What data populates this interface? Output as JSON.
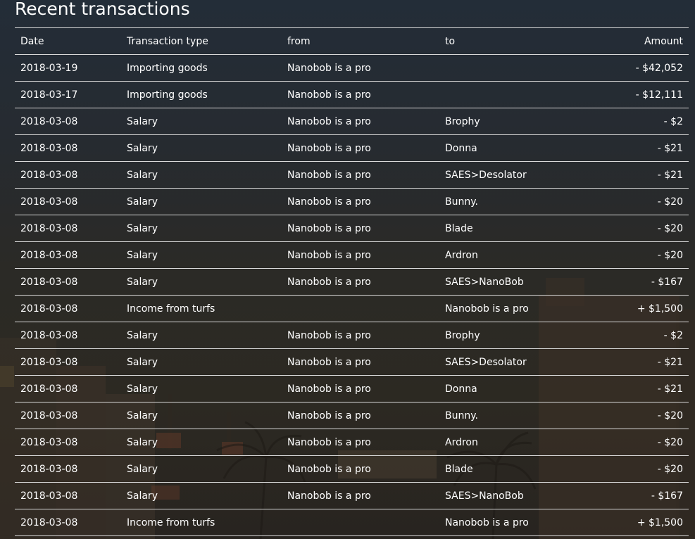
{
  "page": {
    "title": "Recent transactions"
  },
  "table": {
    "columns": {
      "date": "Date",
      "type": "Transaction type",
      "from": "from",
      "to": "to",
      "amount": "Amount"
    },
    "rows": [
      {
        "date": "2018-03-19",
        "type": "Importing goods",
        "from": "Nanobob is a pro",
        "to": "",
        "amount": "- $42,052"
      },
      {
        "date": "2018-03-17",
        "type": "Importing goods",
        "from": "Nanobob is a pro",
        "to": "",
        "amount": "- $12,111"
      },
      {
        "date": "2018-03-08",
        "type": "Salary",
        "from": "Nanobob is a pro",
        "to": "Brophy",
        "amount": "- $2"
      },
      {
        "date": "2018-03-08",
        "type": "Salary",
        "from": "Nanobob is a pro",
        "to": "Donna",
        "amount": "- $21"
      },
      {
        "date": "2018-03-08",
        "type": "Salary",
        "from": "Nanobob is a pro",
        "to": "SAES>Desolator",
        "amount": "- $21"
      },
      {
        "date": "2018-03-08",
        "type": "Salary",
        "from": "Nanobob is a pro",
        "to": "Bunny.",
        "amount": "- $20"
      },
      {
        "date": "2018-03-08",
        "type": "Salary",
        "from": "Nanobob is a pro",
        "to": "Blade",
        "amount": "- $20"
      },
      {
        "date": "2018-03-08",
        "type": "Salary",
        "from": "Nanobob is a pro",
        "to": "Ardron",
        "amount": "- $20"
      },
      {
        "date": "2018-03-08",
        "type": "Salary",
        "from": "Nanobob is a pro",
        "to": "SAES>NanoBob",
        "amount": "- $167"
      },
      {
        "date": "2018-03-08",
        "type": "Income from turfs",
        "from": "",
        "to": "Nanobob is a pro",
        "amount": "+ $1,500"
      },
      {
        "date": "2018-03-08",
        "type": "Salary",
        "from": "Nanobob is a pro",
        "to": "Brophy",
        "amount": "- $2"
      },
      {
        "date": "2018-03-08",
        "type": "Salary",
        "from": "Nanobob is a pro",
        "to": "SAES>Desolator",
        "amount": "- $21"
      },
      {
        "date": "2018-03-08",
        "type": "Salary",
        "from": "Nanobob is a pro",
        "to": "Donna",
        "amount": "- $21"
      },
      {
        "date": "2018-03-08",
        "type": "Salary",
        "from": "Nanobob is a pro",
        "to": "Bunny.",
        "amount": "- $20"
      },
      {
        "date": "2018-03-08",
        "type": "Salary",
        "from": "Nanobob is a pro",
        "to": "Ardron",
        "amount": "- $20"
      },
      {
        "date": "2018-03-08",
        "type": "Salary",
        "from": "Nanobob is a pro",
        "to": "Blade",
        "amount": "- $20"
      },
      {
        "date": "2018-03-08",
        "type": "Salary",
        "from": "Nanobob is a pro",
        "to": "SAES>NanoBob",
        "amount": "- $167"
      },
      {
        "date": "2018-03-08",
        "type": "Income from turfs",
        "from": "",
        "to": "Nanobob is a pro",
        "amount": "+ $1,500"
      }
    ]
  },
  "background": {
    "icon": "city-skyline-background",
    "colors": {
      "sky_top": "#232d38",
      "ground": "#282420",
      "text": "#ffffff",
      "row_divider": "#d9d9d9"
    }
  }
}
